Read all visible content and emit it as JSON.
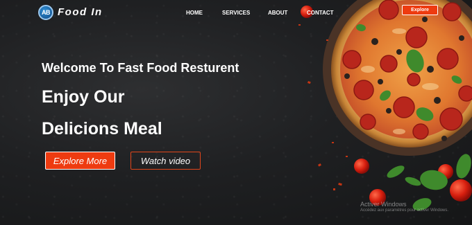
{
  "header": {
    "logo_badge": "AB",
    "brand": "Food In",
    "nav": {
      "home": "HOME",
      "services": "SERVICES",
      "about": "ABOUT",
      "contact": "CONTACT"
    },
    "explore_label": "Explore"
  },
  "hero": {
    "welcome": "Welcome To Fast Food Resturent",
    "headline_line1": "Enjoy Our",
    "headline_line2": "Delicions Meal",
    "primary_button": "Explore More",
    "secondary_button": "Watch video"
  },
  "watermark": {
    "title": "Activer Windows",
    "subtitle": "Accédez aux paramètres pour activer Windows."
  },
  "colors": {
    "accent": "#ee3b10",
    "background": "#1f2022",
    "text": "#ffffff"
  },
  "icons": {
    "logo": "ab-logo-icon",
    "pizza": "pizza-image"
  }
}
